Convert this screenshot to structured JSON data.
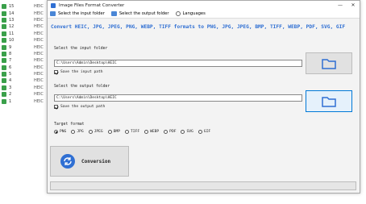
{
  "background_list": [
    {
      "num": "15",
      "ext": "HEIC"
    },
    {
      "num": "14",
      "ext": "HEIC"
    },
    {
      "num": "13",
      "ext": "HEIC"
    },
    {
      "num": "12",
      "ext": "HEIC"
    },
    {
      "num": "11",
      "ext": "HEIC"
    },
    {
      "num": "10",
      "ext": "HEIC"
    },
    {
      "num": "9",
      "ext": "HEIC"
    },
    {
      "num": "8",
      "ext": "HEIC"
    },
    {
      "num": "7",
      "ext": "HEIC"
    },
    {
      "num": "6",
      "ext": "HEIC"
    },
    {
      "num": "5",
      "ext": "HEIC"
    },
    {
      "num": "4",
      "ext": "HEIC"
    },
    {
      "num": "3",
      "ext": "HEIC"
    },
    {
      "num": "2",
      "ext": "HEIC"
    },
    {
      "num": "1",
      "ext": "HEIC"
    }
  ],
  "window": {
    "title": "Image Files Format Converter",
    "minimize": "—",
    "close": "✕"
  },
  "toolbar": {
    "select_input": "Select the input folder",
    "select_output": "Select the output folder",
    "languages": "Languages"
  },
  "headline": "Convert HEIC, JPG, JPEG, PNG, WEBP, TIFF formats to PNG, JPG, JPEG, BMP, TIFF, WEBP, PDF, SVG, GIF",
  "input": {
    "label": "Select the input folder",
    "path": "C:\\Users\\Admin\\Desktop\\HEIC",
    "save_label": "Save the input path"
  },
  "output": {
    "label": "Select the output folder",
    "path": "C:\\Users\\Admin\\Desktop\\HEIC",
    "save_label": "Save the output path"
  },
  "format": {
    "label": "Target format",
    "options": [
      "PNG",
      "JPG",
      "JPEG",
      "BMP",
      "TIFF",
      "WEBP",
      "PDF",
      "SVG",
      "GIF"
    ],
    "selected": "PNG"
  },
  "convert_label": "Conversion",
  "colors": {
    "accent": "#2f6fd3",
    "list_icon": "#3aa04a"
  }
}
